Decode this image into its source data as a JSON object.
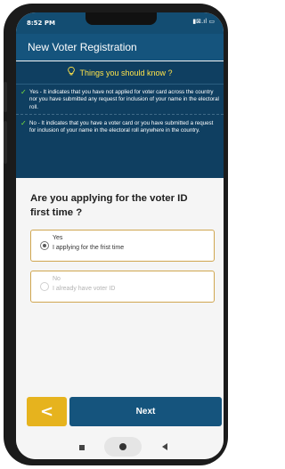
{
  "status_bar": {
    "time": "8:52 PM",
    "icons": "▮⊠.ıl ▭"
  },
  "app_bar": {
    "title": "New Voter Registration"
  },
  "info": {
    "heading": "Things you should know ?",
    "yes_text": "Yes - It indicates that you have not applied for voter card across the country nor you have submitted any request for inclusion of your name in the electoral roll.",
    "no_text": "No - It indicates that you have a voter card or you have submitted a request for inclusion of your name in the electoral roll anywhere in the country."
  },
  "question": "Are you applying for the voter ID first time ?",
  "options": [
    {
      "title": "Yes",
      "subtitle": "I applying for the frist time",
      "selected": true,
      "enabled": true
    },
    {
      "title": "No",
      "subtitle": "I already have voter ID",
      "selected": false,
      "enabled": false
    }
  ],
  "footer": {
    "back_symbol": "<",
    "next_label": "Next"
  },
  "colors": {
    "primary": "#15547d",
    "info_bg": "#0f3f61",
    "accent": "#e6b31e",
    "highlight": "#ffe44a",
    "check": "#7be23a",
    "option_border": "#d0a650"
  },
  "icons": {
    "info_heading": "lightbulb-icon",
    "check": "check-icon",
    "back": "chevron-left-icon"
  }
}
